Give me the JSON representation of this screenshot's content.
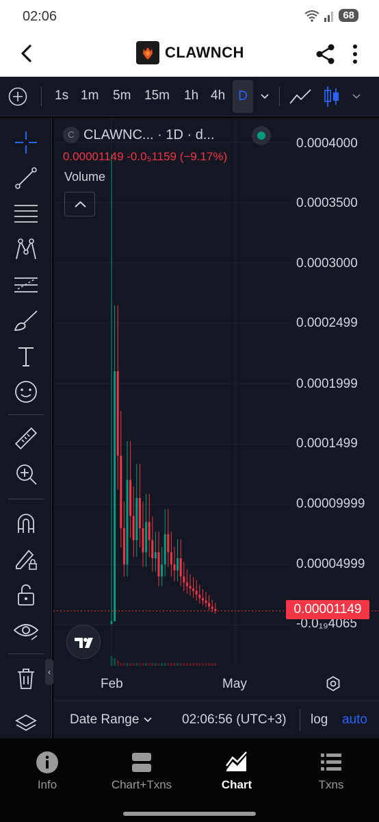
{
  "status_bar": {
    "time": "02:06",
    "battery": "68"
  },
  "header": {
    "title": "CLAWNCH"
  },
  "toolbar": {
    "timeframes": [
      "1s",
      "1m",
      "5m",
      "15m",
      "1h",
      "4h"
    ],
    "active_timeframe": "D"
  },
  "legend": {
    "symbol_initial": "C",
    "symbol_text": "CLAWNC... · 1D · d...",
    "ohlc_text": "0.00001149  -0.0₅1159 (−9.17%)",
    "volume_label": "Volume"
  },
  "price_axis": {
    "labels": [
      "0.0004000",
      "0.0003500",
      "0.0003000",
      "0.0002499",
      "0.0001999",
      "0.0001499",
      "0.00009999",
      "0.00004999",
      "-0.0₁₉4065"
    ],
    "last_price": "0.00001149"
  },
  "time_axis": {
    "labels": [
      "Feb",
      "May"
    ]
  },
  "bottom_bar": {
    "date_range": "Date Range",
    "time": "02:06:56 (UTC+3)",
    "log": "log",
    "auto": "auto"
  },
  "nav": {
    "items": [
      {
        "label": "Info",
        "active": false
      },
      {
        "label": "Chart+Txns",
        "active": false
      },
      {
        "label": "Chart",
        "active": true
      },
      {
        "label": "Txns",
        "active": false
      }
    ]
  },
  "colors": {
    "up": "#089981",
    "down": "#f23645",
    "accent": "#2962ff",
    "background": "#131722"
  },
  "chart_data": {
    "type": "candlestick",
    "interval": "1D",
    "y_range": [
      0,
      0.0004
    ],
    "last_price": 1.149e-05,
    "approx_closes": [
      3e-06,
      0.00021,
      0.00014,
      8e-05,
      5e-05,
      0.00012,
      9e-05,
      7e-05,
      0.000105,
      8e-05,
      6e-05,
      8.5e-05,
      7e-05,
      5.5e-05,
      6e-05,
      4e-05,
      5e-05,
      7.5e-05,
      6e-05,
      5e-05,
      4.5e-05,
      5.5e-05,
      4e-05,
      3.5e-05,
      3.2e-05,
      3e-05,
      2.8e-05,
      2.5e-05,
      2.2e-05,
      2e-05,
      1.8e-05,
      1.5e-05,
      1.3e-05,
      1.15e-05
    ]
  }
}
